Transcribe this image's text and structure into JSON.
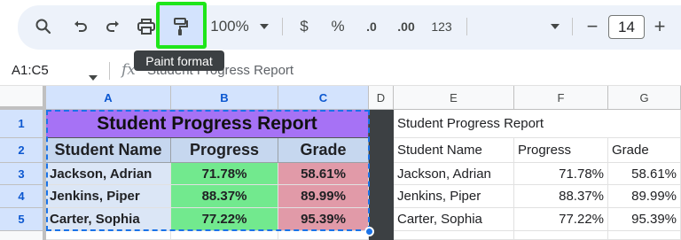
{
  "toolbar": {
    "zoom": "100%",
    "currency": "$",
    "percent": "%",
    "decrease_decimal": ".0",
    "increase_decimal": ".00",
    "number_format": "123",
    "font_size": "14",
    "minus": "−",
    "plus": "+"
  },
  "tooltip": {
    "text": "Paint format"
  },
  "formula_bar": {
    "name_box": "A1:C5",
    "fx": "fx",
    "content": "Student Progress Report"
  },
  "columns": [
    "A",
    "B",
    "C",
    "D",
    "E",
    "F",
    "G"
  ],
  "rows": [
    "1",
    "2",
    "3",
    "4",
    "5"
  ],
  "left_table": {
    "title": "Student Progress Report",
    "headers": [
      "Student Name",
      "Progress",
      "Grade"
    ],
    "records": [
      [
        "Jackson, Adrian",
        "71.78%",
        "58.61%"
      ],
      [
        "Jenkins, Piper",
        "88.37%",
        "89.99%"
      ],
      [
        "Carter, Sophia",
        "77.22%",
        "95.39%"
      ]
    ]
  },
  "right_table": {
    "title": "Student Progress Report",
    "headers": [
      "Student Name",
      "Progress",
      "Grade"
    ],
    "records": [
      [
        "Jackson, Adrian",
        "71.78%",
        "58.61%"
      ],
      [
        "Jenkins, Piper",
        "88.37%",
        "89.99%"
      ],
      [
        "Carter, Sophia",
        "77.22%",
        "95.39%"
      ]
    ]
  },
  "colors": {
    "title_fill": "#a672f5",
    "header_fill": "#c6d7ef",
    "name_fill": "#dbe6f6",
    "progress_fill": "#72e98e",
    "grade_fill": "#e19aa8",
    "selection": "#1a73e8",
    "paint_highlight": "#1ee61a"
  },
  "icons": [
    "search-icon",
    "undo-icon",
    "redo-icon",
    "print-icon",
    "paint-format-icon",
    "chevron-down-icon",
    "decrease-decimal-icon",
    "increase-decimal-icon"
  ]
}
